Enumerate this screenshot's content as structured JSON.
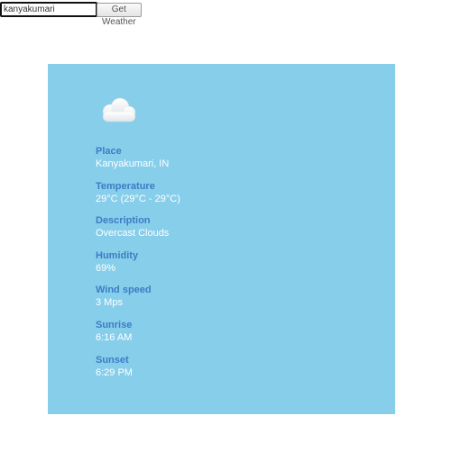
{
  "search": {
    "value": "kanyakumari",
    "button_label": "Get Weather"
  },
  "weather": {
    "icon": "cloud-icon",
    "fields": [
      {
        "label": "Place",
        "value": "Kanyakumari, IN"
      },
      {
        "label": "Temperature",
        "value": "29°C (29°C - 29°C)"
      },
      {
        "label": "Description",
        "value": "Overcast Clouds"
      },
      {
        "label": "Humidity",
        "value": "69%"
      },
      {
        "label": "Wind speed",
        "value": "3 Mps"
      },
      {
        "label": "Sunrise",
        "value": "6:16 AM"
      },
      {
        "label": "Sunset",
        "value": "6:29 PM"
      }
    ]
  },
  "colors": {
    "card_background": "#87ceeb",
    "label": "#3b7dc4",
    "value": "#ffffff"
  }
}
